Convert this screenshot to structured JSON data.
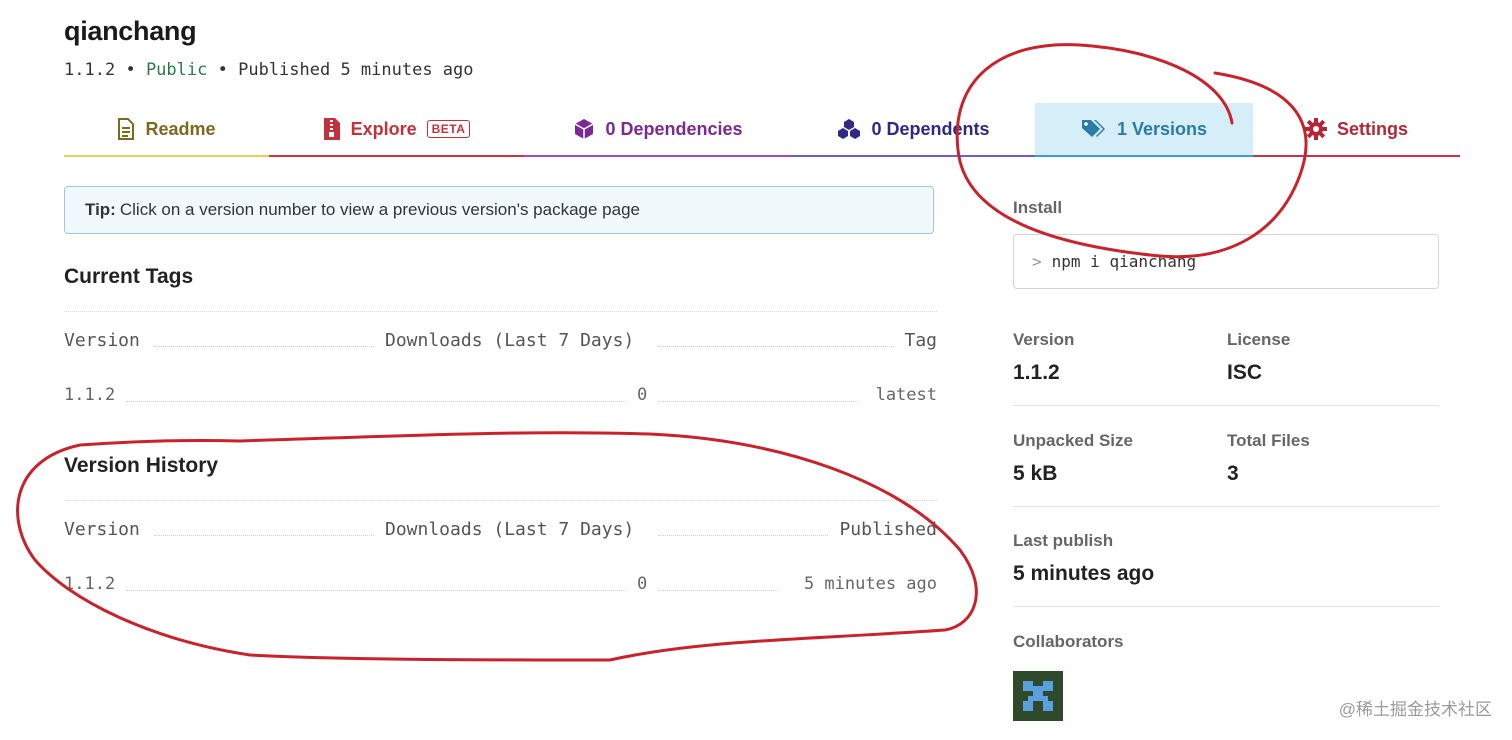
{
  "package": {
    "name": "qianchang",
    "version": "1.1.2",
    "sep1": "•",
    "visibility": "Public",
    "sep2": "•",
    "published": "Published 5 minutes ago"
  },
  "tabs": [
    {
      "label": "Readme",
      "icon": "document-icon",
      "color": "#7a6b1e"
    },
    {
      "label": "Explore",
      "badge": "BETA",
      "icon": "zip-file-icon",
      "color": "#c0323c"
    },
    {
      "label": "0 Dependencies",
      "icon": "cube-icon",
      "color": "#7b2a8f"
    },
    {
      "label": "0 Dependents",
      "icon": "cubes-icon",
      "color": "#2f2a86"
    },
    {
      "label": "1 Versions",
      "icon": "tags-icon",
      "color": "#2a7ba8",
      "active": true
    },
    {
      "label": "Settings",
      "icon": "gear-icon",
      "color": "#b32737"
    }
  ],
  "tip": {
    "strong": "Tip:",
    "text": "Click on a version number to view a previous version's package page"
  },
  "current_tags": {
    "title": "Current Tags",
    "headers": [
      "Version",
      "Downloads (Last 7 Days)",
      "Tag"
    ],
    "rows": [
      {
        "version": "1.1.2",
        "downloads": "0",
        "tag": "latest"
      }
    ]
  },
  "version_history": {
    "title": "Version History",
    "headers": [
      "Version",
      "Downloads (Last 7 Days)",
      "Published"
    ],
    "rows": [
      {
        "version": "1.1.2",
        "downloads": "0",
        "published": "5 minutes ago"
      }
    ]
  },
  "sidebar": {
    "install_label": "Install",
    "install_prompt": ">",
    "install_command": "npm i qianchang",
    "version_label": "Version",
    "version_value": "1.1.2",
    "license_label": "License",
    "license_value": "ISC",
    "unpacked_label": "Unpacked Size",
    "unpacked_value": "5 kB",
    "files_label": "Total Files",
    "files_value": "3",
    "last_publish_label": "Last publish",
    "last_publish_value": "5 minutes ago",
    "collaborators_label": "Collaborators",
    "collaborator_avatar": "pixel-avatar-icon"
  },
  "watermark": "@稀土掘金技术社区",
  "colors": {
    "annotation": "#c8232c",
    "tip_background": "#f2f9fc",
    "active_tab_background": "#d6eef8"
  }
}
